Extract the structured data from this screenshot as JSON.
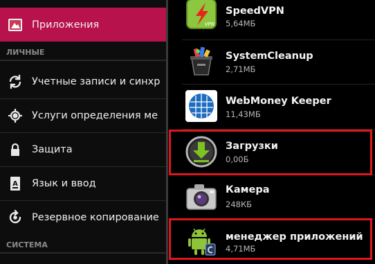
{
  "settings": {
    "selected_item": {
      "label": "Приложения",
      "icon": "apps-icon"
    },
    "section_personal": "ЛИЧНЫЕ",
    "items": [
      {
        "label": "Учетные записи и синхр",
        "icon": "sync-icon"
      },
      {
        "label": "Услуги определения ме",
        "icon": "location-icon"
      },
      {
        "label": "Защита",
        "icon": "lock-icon"
      },
      {
        "label": "Язык и ввод",
        "icon": "keyboard-language-icon"
      },
      {
        "label": "Резервное копирование",
        "icon": "backup-icon"
      }
    ],
    "section_system": "СИСТЕМА"
  },
  "apps": [
    {
      "name": "SpeedVPN",
      "size": "5,64МБ",
      "icon": "speedvpn-icon"
    },
    {
      "name": "SystemCleanup",
      "size": "2,71МБ",
      "icon": "systemcleanup-icon"
    },
    {
      "name": "WebMoney Keeper",
      "size": "11,43МБ",
      "icon": "webmoney-icon"
    },
    {
      "name": "Загрузки",
      "size": "0,00Б",
      "icon": "downloads-icon",
      "highlighted": true
    },
    {
      "name": "Камера",
      "size": "248КБ",
      "icon": "camera-icon"
    },
    {
      "name": "менеджер приложений",
      "size": "4,71МБ",
      "icon": "android-app-manager-icon",
      "highlighted": true
    }
  ],
  "colors": {
    "selected": "#b8124c",
    "highlight_box": "#e0161f",
    "background": "#000000"
  }
}
